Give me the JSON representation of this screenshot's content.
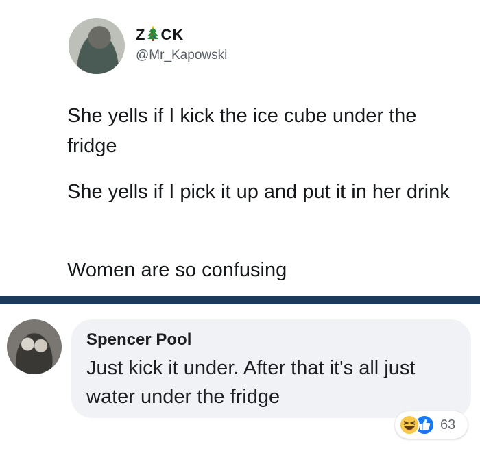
{
  "tweet": {
    "name_left": "Z",
    "name_right": "CK",
    "handle": "@Mr_Kapowski",
    "lines": [
      "She yells if I kick the ice cube under the fridge",
      "She yells if I pick it up and put it in her drink",
      "Women are so confusing"
    ]
  },
  "comment": {
    "author": "Spencer Pool",
    "text": "Just kick it under. After that it's all just water under the fridge",
    "reactions": {
      "icons": [
        "haha-icon",
        "like-icon"
      ],
      "count": "63"
    }
  },
  "colors": {
    "divider": "#1c3a5c",
    "like_blue": "#1877f2",
    "haha_yellow": "#f7c94b",
    "tree_green": "#2e8b3a"
  }
}
